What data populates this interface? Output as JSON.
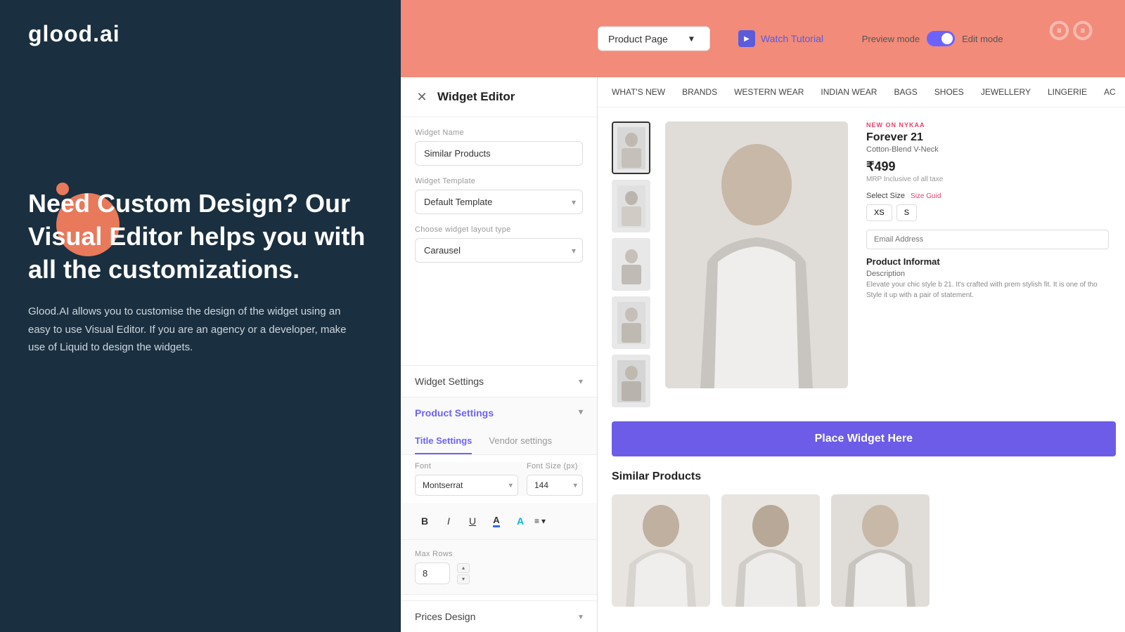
{
  "logo": {
    "text": "glood.ai"
  },
  "left_panel": {
    "heading": "Need Custom Design? Our Visual Editor helps you with all the customizations.",
    "description": "Glood.AI allows you to customise the design of the widget using an easy to use Visual Editor. If you are an agency or a developer, make use of Liquid to design the widgets."
  },
  "toolbar": {
    "page_selector_value": "Product Page",
    "page_selector_chevron": "▾",
    "watch_tutorial_label": "Watch Tutorial",
    "preview_mode_label": "Preview mode",
    "edit_mode_label": "Edit mode"
  },
  "widget_editor": {
    "title": "Widget Editor",
    "close_icon": "✕",
    "widget_name_label": "Widget Name",
    "widget_name_value": "Similar Products",
    "widget_template_label": "Widget Template",
    "widget_template_value": "Default Template",
    "layout_type_label": "Choose widget layout type",
    "layout_type_value": "Carausel",
    "widget_settings_label": "Widget Settings",
    "product_settings_label": "Product Settings",
    "prices_design_label": "Prices Design",
    "tab_title": "Title Settings",
    "tab_vendor": "Vendor settings",
    "font_label": "Font",
    "font_value": "Montserrat",
    "font_size_label": "Font Size (px)",
    "font_size_value": "144",
    "max_rows_label": "Max Rows",
    "max_rows_value": "8",
    "format_bold": "B",
    "format_italic": "I",
    "format_underline": "U",
    "format_align": "≡"
  },
  "preview": {
    "nav_items": [
      "WHAT'S NEW",
      "BRANDS",
      "WESTERN WEAR",
      "INDIAN WEAR",
      "BAGS",
      "SHOES",
      "JEWELLERY",
      "LINGERIE",
      "AC"
    ],
    "product": {
      "badge": "NEW ON NYKAA",
      "name": "Forever 21",
      "subtitle": "Cotton-Blend V-Neck",
      "price": "₹499",
      "price_note": "MRP Inclusive of all taxe",
      "size_label": "Select Size",
      "size_guide": "Size Guid",
      "sizes": [
        "XS",
        "S"
      ],
      "email_placeholder": "Email Address",
      "info_heading": "Product Informat",
      "description_label": "Description",
      "description_text": "Elevate your chic style b 21. It's crafted with prem stylish fit. It is one of tho Style it up with a pair of statement."
    },
    "place_widget_label": "Place Widget Here",
    "similar_products_title": "Similar Products",
    "similar_items_count": 3
  },
  "icons": {
    "chevron_down": "▾",
    "chevron_up": "▴",
    "play": "▶",
    "align_dropdown": "▾"
  }
}
